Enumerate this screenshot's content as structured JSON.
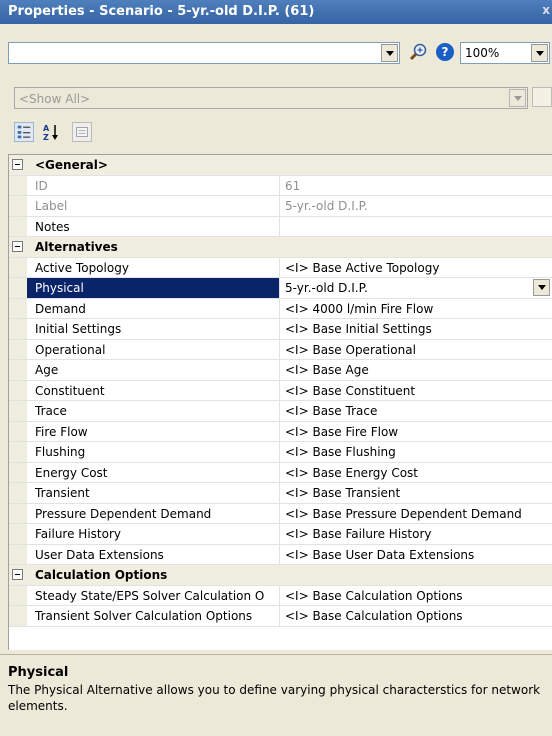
{
  "window": {
    "title": "Properties - Scenario - 5-yr.-old D.I.P. (61)",
    "close": "x"
  },
  "toolbar": {
    "element_combo_value": "",
    "zoom_value": "100%"
  },
  "filter": {
    "value": "<Show All>"
  },
  "grid": {
    "rows": [
      {
        "kind": "category",
        "label": "<General>"
      },
      {
        "kind": "prop",
        "name": "ID",
        "value": "61",
        "disabled": true
      },
      {
        "kind": "prop",
        "name": "Label",
        "value": "5-yr.-old D.I.P.",
        "disabled": true
      },
      {
        "kind": "prop",
        "name": "Notes",
        "value": ""
      },
      {
        "kind": "category",
        "label": "Alternatives"
      },
      {
        "kind": "prop",
        "name": "Active Topology",
        "value": "<I> Base Active Topology"
      },
      {
        "kind": "prop",
        "name": "Physical",
        "value": "5-yr.-old D.I.P.",
        "selected": true
      },
      {
        "kind": "prop",
        "name": "Demand",
        "value": "<I> 4000 l/min Fire Flow"
      },
      {
        "kind": "prop",
        "name": "Initial Settings",
        "value": "<I> Base Initial Settings"
      },
      {
        "kind": "prop",
        "name": "Operational",
        "value": "<I> Base Operational"
      },
      {
        "kind": "prop",
        "name": "Age",
        "value": "<I> Base Age"
      },
      {
        "kind": "prop",
        "name": "Constituent",
        "value": "<I> Base Constituent"
      },
      {
        "kind": "prop",
        "name": "Trace",
        "value": "<I> Base Trace"
      },
      {
        "kind": "prop",
        "name": "Fire Flow",
        "value": "<I> Base Fire Flow"
      },
      {
        "kind": "prop",
        "name": "Flushing",
        "value": "<I> Base Flushing"
      },
      {
        "kind": "prop",
        "name": "Energy Cost",
        "value": "<I> Base Energy Cost"
      },
      {
        "kind": "prop",
        "name": "Transient",
        "value": "<I> Base Transient"
      },
      {
        "kind": "prop",
        "name": "Pressure Dependent Demand",
        "value": "<I> Base Pressure Dependent Demand"
      },
      {
        "kind": "prop",
        "name": "Failure History",
        "value": "<I> Base Failure History"
      },
      {
        "kind": "prop",
        "name": "User Data Extensions",
        "value": "<I> Base User Data Extensions"
      },
      {
        "kind": "category",
        "label": "Calculation Options"
      },
      {
        "kind": "prop",
        "name": "Steady State/EPS Solver Calculation O",
        "value": "<I> Base Calculation Options"
      },
      {
        "kind": "prop",
        "name": "Transient Solver Calculation Options",
        "value": "<I> Base Calculation Options"
      }
    ]
  },
  "help": {
    "title": "Physical",
    "text": "The Physical Alternative allows you to define varying physical characterstics for network elements."
  },
  "colors": {
    "titlebar": "#3D6DB0",
    "selection": "#0A246A",
    "panel": "#ECE9D8"
  }
}
